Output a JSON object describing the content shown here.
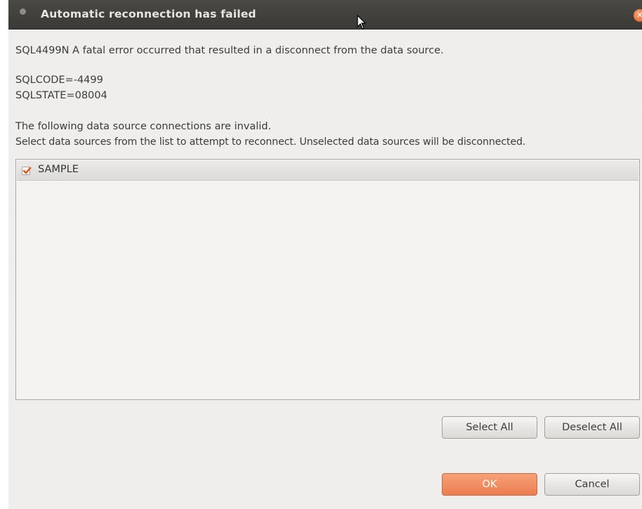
{
  "window": {
    "title": "Automatic reconnection has failed"
  },
  "message": {
    "error_line": "SQL4499N  A fatal error occurred that resulted in a disconnect from the data source.",
    "sqlcode": "SQLCODE=-4499",
    "sqlstate": "SQLSTATE=08004",
    "invalid_notice": "The following data source connections are invalid.",
    "instruction": "Select data sources from the list to attempt to reconnect. Unselected data sources will be disconnected."
  },
  "data_sources": {
    "items": [
      {
        "label": "SAMPLE",
        "checked": true
      }
    ]
  },
  "buttons": {
    "select_all": "Select All",
    "deselect_all": "Deselect All",
    "ok": "OK",
    "cancel": "Cancel"
  },
  "colors": {
    "titlebar": "#3c3b37",
    "accent": "#f07746",
    "close": "#e65a23"
  }
}
